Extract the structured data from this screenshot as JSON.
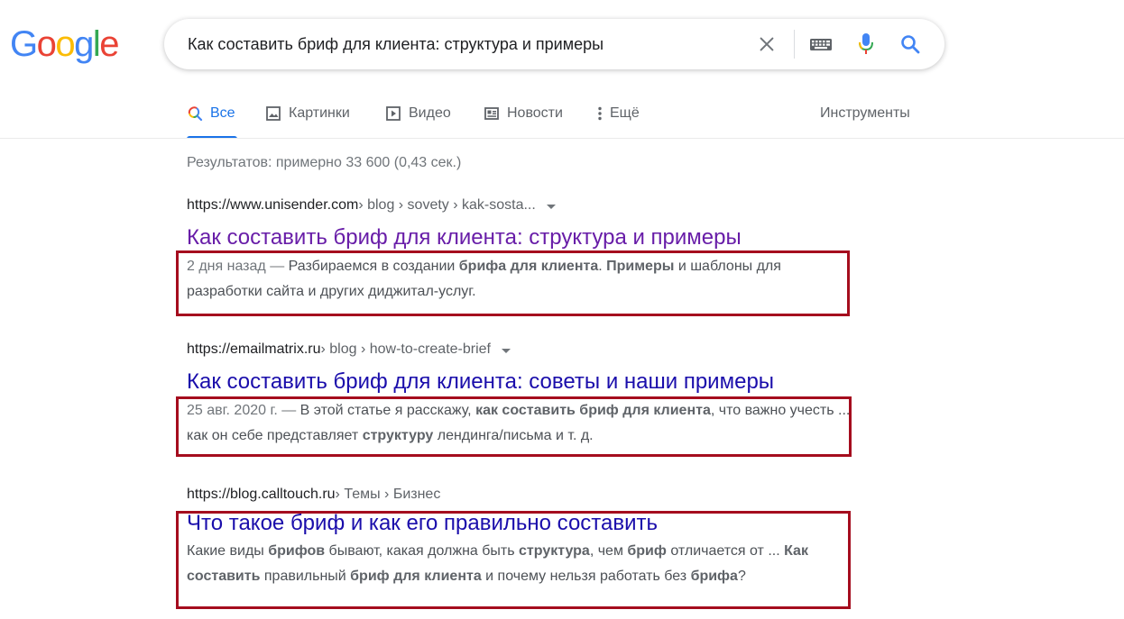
{
  "logo": {
    "letters": [
      "G",
      "o",
      "o",
      "g",
      "l",
      "e"
    ],
    "colors": [
      "#4285f4",
      "#ea4335",
      "#fbbc05",
      "#4285f4",
      "#34a853",
      "#ea4335"
    ]
  },
  "search": {
    "query": "Как составить бриф для клиента: структура и примеры"
  },
  "icons": {
    "clear": "close-icon",
    "keyboard": "keyboard-icon",
    "voice": "microphone-icon",
    "search": "search-icon"
  },
  "tabs": [
    {
      "label": "Все",
      "icon": "search-icon",
      "active": true
    },
    {
      "label": "Картинки",
      "icon": "image-icon",
      "active": false
    },
    {
      "label": "Видео",
      "icon": "video-icon",
      "active": false
    },
    {
      "label": "Новости",
      "icon": "news-icon",
      "active": false
    },
    {
      "label": "Ещё",
      "icon": "more-vert-icon",
      "active": false
    }
  ],
  "tools_label": "Инструменты",
  "stats": "Результатов: примерно 33 600 (0,43 сек.)",
  "results": [
    {
      "site": "https://www.unisender.com",
      "path": " › blog › sovety › kak-sosta...",
      "has_menu": true,
      "title": "Как составить бриф для клиента: структура и примеры",
      "visited": true,
      "date": "2 дня назад — ",
      "snippet": [
        {
          "t": "Разбираемся в создании ",
          "b": false
        },
        {
          "t": "брифа для клиента",
          "b": true
        },
        {
          "t": ". ",
          "b": false
        },
        {
          "t": "Примеры",
          "b": true
        },
        {
          "t": " и шаблоны для разработки сайта и других диджитал-услуг.",
          "b": false
        }
      ]
    },
    {
      "site": "https://emailmatrix.ru",
      "path": " › blog › how-to-create-brief",
      "has_menu": true,
      "title": "Как составить бриф для клиента: советы и наши примеры",
      "visited": false,
      "date": "25 авг. 2020 г. — ",
      "snippet": [
        {
          "t": "В этой статье я расскажу, ",
          "b": false
        },
        {
          "t": "как составить бриф для клиента",
          "b": true
        },
        {
          "t": ", что важно учесть ... как он себе представляет ",
          "b": false
        },
        {
          "t": "структуру",
          "b": true
        },
        {
          "t": " лендинга/письма и т. д.",
          "b": false
        }
      ]
    },
    {
      "site": "https://blog.calltouch.ru",
      "path": " › Темы › Бизнес",
      "has_menu": false,
      "title": "Что такое бриф и как его правильно составить",
      "visited": false,
      "date": "",
      "snippet": [
        {
          "t": "Какие виды ",
          "b": false
        },
        {
          "t": "брифов",
          "b": true
        },
        {
          "t": " бывают, какая должна быть ",
          "b": false
        },
        {
          "t": "структура",
          "b": true
        },
        {
          "t": ", чем ",
          "b": false
        },
        {
          "t": "бриф",
          "b": true
        },
        {
          "t": " отличается от ... ",
          "b": false
        },
        {
          "t": "Как составить",
          "b": true
        },
        {
          "t": " правильный ",
          "b": false
        },
        {
          "t": "бриф для клиента",
          "b": true
        },
        {
          "t": " и почему нельзя работать без ",
          "b": false
        },
        {
          "t": "брифа",
          "b": true
        },
        {
          "t": "?",
          "b": false
        }
      ]
    }
  ],
  "highlight_color": "#a50d1e"
}
